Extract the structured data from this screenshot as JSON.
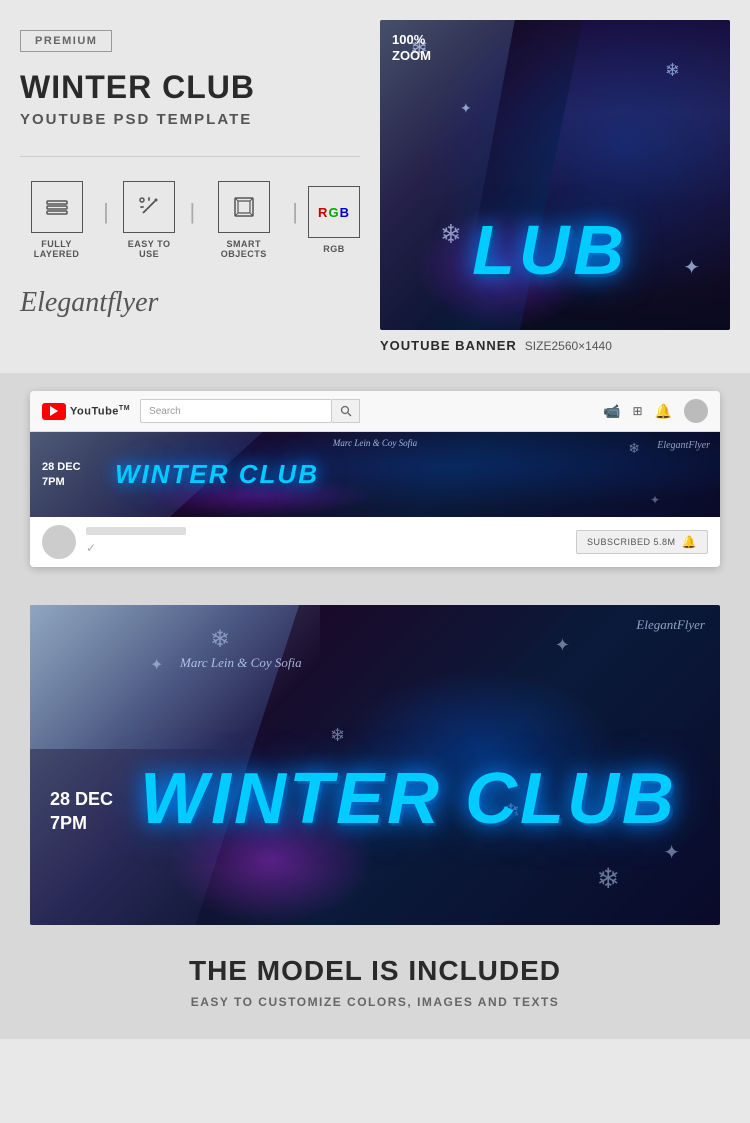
{
  "badge": {
    "label": "PREMIUM"
  },
  "header": {
    "title": "WINTER CLUB",
    "subtitle": "YOUTUBE PSD TEMPLATE"
  },
  "features": [
    {
      "label": "FULLY LAYERED",
      "icon": "layers"
    },
    {
      "label": "EASY TO USE",
      "icon": "wand"
    },
    {
      "label": "SMART OBJECTS",
      "icon": "smart"
    },
    {
      "label": "RGB",
      "icon": "rgb"
    }
  ],
  "brand": {
    "name": "Elegantflyer"
  },
  "preview": {
    "zoom_label": "100%\nZOOM",
    "title_text": "LUB"
  },
  "banner_label": {
    "type": "YOUTUBE BANNER",
    "size": "SIZE2560×1440"
  },
  "youtube_mockup": {
    "search_placeholder": "Search",
    "banner": {
      "date": "28 DEC\n7PM",
      "title": "WINTER CLUB",
      "artist": "Marc Lein & Coy Sofia",
      "brand": "ElegantFlyer"
    },
    "channel": {
      "subscribe_label": "SUBSCRIBED  5.8M"
    }
  },
  "large_banner": {
    "date": "28 DEC\n7PM",
    "title": "WINTER CLUB",
    "artist": "Marc Lein & Coy Sofia",
    "brand": "ElegantFlyer"
  },
  "footer": {
    "title": "THE MODEL IS INCLUDED",
    "subtitle": "EASY TO CUSTOMIZE COLORS, IMAGES AND TEXTS"
  }
}
